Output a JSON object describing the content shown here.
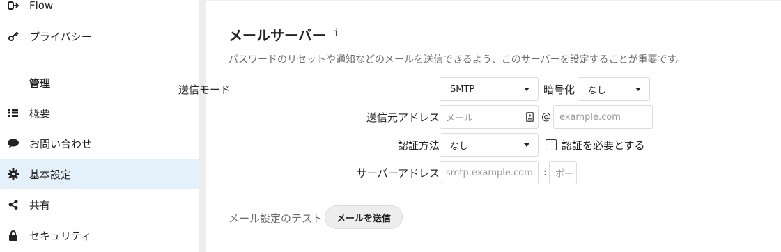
{
  "sidebar": {
    "items": [
      {
        "label": "Flow",
        "icon": "flow-icon"
      },
      {
        "label": "プライバシー",
        "icon": "key-icon"
      }
    ],
    "section_caption": "管理",
    "admin_items": [
      {
        "label": "概要",
        "icon": "list-icon"
      },
      {
        "label": "お問い合わせ",
        "icon": "speech-bubble-icon"
      },
      {
        "label": "基本設定",
        "icon": "gear-icon",
        "active": true
      },
      {
        "label": "共有",
        "icon": "share-icon"
      },
      {
        "label": "セキュリティ",
        "icon": "lock-icon"
      }
    ]
  },
  "main": {
    "title": "メールサーバー",
    "info_icon": "i",
    "description": "パスワードのリセットや通知などのメールを送信できるよう、このサーバーを設定することが重要です。",
    "send_mode": {
      "label": "送信モード",
      "value": "SMTP"
    },
    "encryption": {
      "label": "暗号化",
      "value": "なし"
    },
    "from_address": {
      "label": "送信元アドレス",
      "placeholder": "メール",
      "at": "@",
      "domain_placeholder": "example.com"
    },
    "auth_method": {
      "label": "認証方法",
      "value": "なし"
    },
    "auth_required": {
      "label": "認証を必要とする",
      "checked": false
    },
    "server_address": {
      "label": "サーバーアドレス",
      "placeholder": "smtp.example.com",
      "colon": ":",
      "port_placeholder": "ポート"
    },
    "test": {
      "label": "メール設定のテスト",
      "button": "メールを送信"
    }
  },
  "colors": {
    "active_bg": "#e5f1fa",
    "divider": "#ededed",
    "muted_text": "#6b6b6b"
  }
}
